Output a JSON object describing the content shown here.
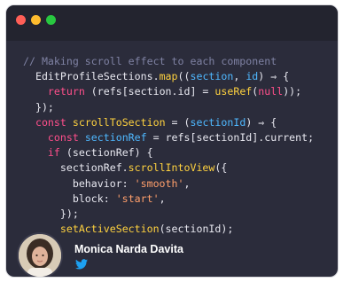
{
  "window": {
    "controls": [
      "close",
      "minimize",
      "maximize"
    ],
    "colors": {
      "background": "#2b2c3b",
      "titlebar": "#23242f",
      "close": "#ff5f57",
      "minimize": "#febc2e",
      "maximize": "#28c840"
    }
  },
  "code": {
    "lines": [
      [
        {
          "t": "comment",
          "v": "// Making scroll effect to each component"
        }
      ],
      [
        {
          "t": "plain",
          "v": "  EditProfileSections."
        },
        {
          "t": "fn",
          "v": "map"
        },
        {
          "t": "plain",
          "v": "(("
        },
        {
          "t": "var",
          "v": "section"
        },
        {
          "t": "plain",
          "v": ", "
        },
        {
          "t": "var",
          "v": "id"
        },
        {
          "t": "plain",
          "v": ") ⇒ {"
        }
      ],
      [
        {
          "t": "kw",
          "v": "    return"
        },
        {
          "t": "plain",
          "v": " (refs[section.id] = "
        },
        {
          "t": "fn",
          "v": "useRef"
        },
        {
          "t": "plain",
          "v": "("
        },
        {
          "t": "kw",
          "v": "null"
        },
        {
          "t": "plain",
          "v": "));"
        }
      ],
      [
        {
          "t": "plain",
          "v": "  });"
        }
      ],
      [
        {
          "t": "kw",
          "v": "  const"
        },
        {
          "t": "plain",
          "v": " "
        },
        {
          "t": "fn",
          "v": "scrollToSection"
        },
        {
          "t": "plain",
          "v": " = ("
        },
        {
          "t": "var",
          "v": "sectionId"
        },
        {
          "t": "plain",
          "v": ") ⇒ {"
        }
      ],
      [
        {
          "t": "kw",
          "v": "    const"
        },
        {
          "t": "plain",
          "v": " "
        },
        {
          "t": "var",
          "v": "sectionRef"
        },
        {
          "t": "plain",
          "v": " = refs[sectionId].current;"
        }
      ],
      [
        {
          "t": "kw",
          "v": "    if"
        },
        {
          "t": "plain",
          "v": " (sectionRef) {"
        }
      ],
      [
        {
          "t": "plain",
          "v": "      sectionRef."
        },
        {
          "t": "fn",
          "v": "scrollIntoView"
        },
        {
          "t": "plain",
          "v": "({"
        }
      ],
      [
        {
          "t": "plain",
          "v": "        behavior: "
        },
        {
          "t": "str",
          "v": "'smooth'"
        },
        {
          "t": "plain",
          "v": ","
        }
      ],
      [
        {
          "t": "plain",
          "v": "        block: "
        },
        {
          "t": "str",
          "v": "'start'"
        },
        {
          "t": "plain",
          "v": ","
        }
      ],
      [
        {
          "t": "plain",
          "v": "      });"
        }
      ],
      [
        {
          "t": "plain",
          "v": "      "
        },
        {
          "t": "fn",
          "v": "setActiveSection"
        },
        {
          "t": "plain",
          "v": "(sectionId);"
        }
      ]
    ]
  },
  "author": {
    "name": "Monica Narda Davita",
    "social_icon": "twitter-icon",
    "social_color": "#1da1f2"
  }
}
